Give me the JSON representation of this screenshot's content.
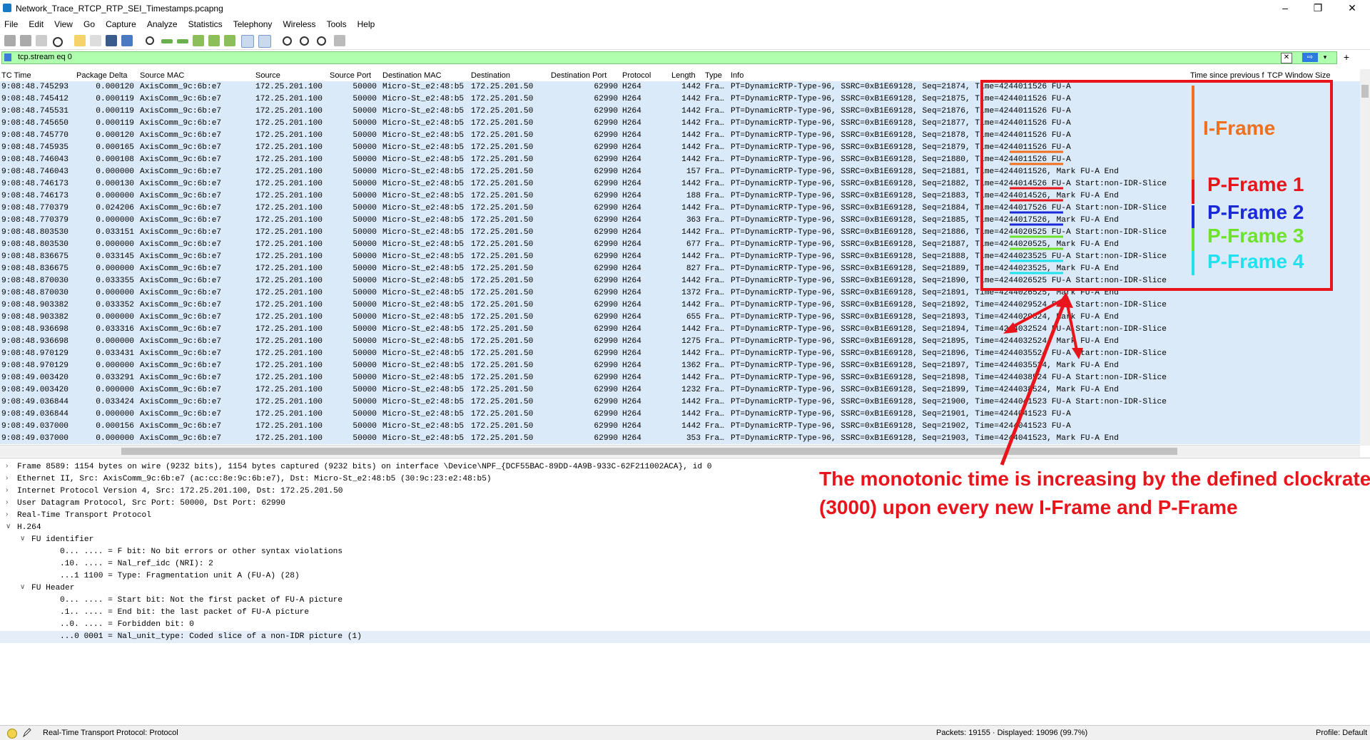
{
  "window": {
    "title": "Network_Trace_RTCP_RTP_SEI_Timestamps.pcapng",
    "min": "–",
    "max": "❐",
    "close": "✕"
  },
  "menu": [
    "File",
    "Edit",
    "View",
    "Go",
    "Capture",
    "Analyze",
    "Statistics",
    "Telephony",
    "Wireless",
    "Tools",
    "Help"
  ],
  "filter": {
    "value": "tcp.stream eq 0",
    "clear": "✕",
    "apply": "⇨",
    "dropdown": "▾",
    "add": "+"
  },
  "columns": [
    "TC Time",
    "Package Delta",
    "Source MAC",
    "Source",
    "Source Port",
    "Destination MAC",
    "Destination",
    "Destination Port",
    "Protocol",
    "Length",
    "Type",
    "Info",
    "Time since previous f",
    "TCP Window Size"
  ],
  "packets": [
    {
      "time": "9:08:48.745293",
      "delta": "0.000120",
      "smac": "AxisComm_9c:6b:e7",
      "src": "172.25.201.100",
      "sport": "50000",
      "dmac": "Micro-St_e2:48:b5",
      "dst": "172.25.201.50",
      "dport": "62990",
      "proto": "H264",
      "len": "1442",
      "type": "Fra…",
      "info": "PT=DynamicRTP-Type-96, SSRC=0xB1E69128, Seq=21874, Time=4244011526 FU-A"
    },
    {
      "time": "9:08:48.745412",
      "delta": "0.000119",
      "smac": "AxisComm_9c:6b:e7",
      "src": "172.25.201.100",
      "sport": "50000",
      "dmac": "Micro-St_e2:48:b5",
      "dst": "172.25.201.50",
      "dport": "62990",
      "proto": "H264",
      "len": "1442",
      "type": "Fra…",
      "info": "PT=DynamicRTP-Type-96, SSRC=0xB1E69128, Seq=21875, Time=4244011526 FU-A"
    },
    {
      "time": "9:08:48.745531",
      "delta": "0.000119",
      "smac": "AxisComm_9c:6b:e7",
      "src": "172.25.201.100",
      "sport": "50000",
      "dmac": "Micro-St_e2:48:b5",
      "dst": "172.25.201.50",
      "dport": "62990",
      "proto": "H264",
      "len": "1442",
      "type": "Fra…",
      "info": "PT=DynamicRTP-Type-96, SSRC=0xB1E69128, Seq=21876, Time=4244011526 FU-A"
    },
    {
      "time": "9:08:48.745650",
      "delta": "0.000119",
      "smac": "AxisComm_9c:6b:e7",
      "src": "172.25.201.100",
      "sport": "50000",
      "dmac": "Micro-St_e2:48:b5",
      "dst": "172.25.201.50",
      "dport": "62990",
      "proto": "H264",
      "len": "1442",
      "type": "Fra…",
      "info": "PT=DynamicRTP-Type-96, SSRC=0xB1E69128, Seq=21877, Time=4244011526 FU-A"
    },
    {
      "time": "9:08:48.745770",
      "delta": "0.000120",
      "smac": "AxisComm_9c:6b:e7",
      "src": "172.25.201.100",
      "sport": "50000",
      "dmac": "Micro-St_e2:48:b5",
      "dst": "172.25.201.50",
      "dport": "62990",
      "proto": "H264",
      "len": "1442",
      "type": "Fra…",
      "info": "PT=DynamicRTP-Type-96, SSRC=0xB1E69128, Seq=21878, Time=4244011526 FU-A"
    },
    {
      "time": "9:08:48.745935",
      "delta": "0.000165",
      "smac": "AxisComm_9c:6b:e7",
      "src": "172.25.201.100",
      "sport": "50000",
      "dmac": "Micro-St_e2:48:b5",
      "dst": "172.25.201.50",
      "dport": "62990",
      "proto": "H264",
      "len": "1442",
      "type": "Fra…",
      "info": "PT=DynamicRTP-Type-96, SSRC=0xB1E69128, Seq=21879, Time=4244011526 FU-A"
    },
    {
      "time": "9:08:48.746043",
      "delta": "0.000108",
      "smac": "AxisComm_9c:6b:e7",
      "src": "172.25.201.100",
      "sport": "50000",
      "dmac": "Micro-St_e2:48:b5",
      "dst": "172.25.201.50",
      "dport": "62990",
      "proto": "H264",
      "len": "1442",
      "type": "Fra…",
      "info": "PT=DynamicRTP-Type-96, SSRC=0xB1E69128, Seq=21880, Time=4244011526 FU-A"
    },
    {
      "time": "9:08:48.746043",
      "delta": "0.000000",
      "smac": "AxisComm_9c:6b:e7",
      "src": "172.25.201.100",
      "sport": "50000",
      "dmac": "Micro-St_e2:48:b5",
      "dst": "172.25.201.50",
      "dport": "62990",
      "proto": "H264",
      "len": "157",
      "type": "Fra…",
      "info": "PT=DynamicRTP-Type-96, SSRC=0xB1E69128, Seq=21881, Time=4244011526, Mark FU-A End"
    },
    {
      "time": "9:08:48.746173",
      "delta": "0.000130",
      "smac": "AxisComm_9c:6b:e7",
      "src": "172.25.201.100",
      "sport": "50000",
      "dmac": "Micro-St_e2:48:b5",
      "dst": "172.25.201.50",
      "dport": "62990",
      "proto": "H264",
      "len": "1442",
      "type": "Fra…",
      "info": "PT=DynamicRTP-Type-96, SSRC=0xB1E69128, Seq=21882, Time=4244014526 FU-A Start:non-IDR-Slice"
    },
    {
      "time": "9:08:48.746173",
      "delta": "0.000000",
      "smac": "AxisComm_9c:6b:e7",
      "src": "172.25.201.100",
      "sport": "50000",
      "dmac": "Micro-St_e2:48:b5",
      "dst": "172.25.201.50",
      "dport": "62990",
      "proto": "H264",
      "len": "188",
      "type": "Fra…",
      "info": "PT=DynamicRTP-Type-96, SSRC=0xB1E69128, Seq=21883, Time=4244014526, Mark FU-A End"
    },
    {
      "time": "9:08:48.770379",
      "delta": "0.024206",
      "smac": "AxisComm_9c:6b:e7",
      "src": "172.25.201.100",
      "sport": "50000",
      "dmac": "Micro-St_e2:48:b5",
      "dst": "172.25.201.50",
      "dport": "62990",
      "proto": "H264",
      "len": "1442",
      "type": "Fra…",
      "info": "PT=DynamicRTP-Type-96, SSRC=0xB1E69128, Seq=21884, Time=4244017526 FU-A Start:non-IDR-Slice"
    },
    {
      "time": "9:08:48.770379",
      "delta": "0.000000",
      "smac": "AxisComm_9c:6b:e7",
      "src": "172.25.201.100",
      "sport": "50000",
      "dmac": "Micro-St_e2:48:b5",
      "dst": "172.25.201.50",
      "dport": "62990",
      "proto": "H264",
      "len": "363",
      "type": "Fra…",
      "info": "PT=DynamicRTP-Type-96, SSRC=0xB1E69128, Seq=21885, Time=4244017526, Mark FU-A End"
    },
    {
      "time": "9:08:48.803530",
      "delta": "0.033151",
      "smac": "AxisComm_9c:6b:e7",
      "src": "172.25.201.100",
      "sport": "50000",
      "dmac": "Micro-St_e2:48:b5",
      "dst": "172.25.201.50",
      "dport": "62990",
      "proto": "H264",
      "len": "1442",
      "type": "Fra…",
      "info": "PT=DynamicRTP-Type-96, SSRC=0xB1E69128, Seq=21886, Time=4244020525 FU-A Start:non-IDR-Slice"
    },
    {
      "time": "9:08:48.803530",
      "delta": "0.000000",
      "smac": "AxisComm_9c:6b:e7",
      "src": "172.25.201.100",
      "sport": "50000",
      "dmac": "Micro-St_e2:48:b5",
      "dst": "172.25.201.50",
      "dport": "62990",
      "proto": "H264",
      "len": "677",
      "type": "Fra…",
      "info": "PT=DynamicRTP-Type-96, SSRC=0xB1E69128, Seq=21887, Time=4244020525, Mark FU-A End"
    },
    {
      "time": "9:08:48.836675",
      "delta": "0.033145",
      "smac": "AxisComm_9c:6b:e7",
      "src": "172.25.201.100",
      "sport": "50000",
      "dmac": "Micro-St_e2:48:b5",
      "dst": "172.25.201.50",
      "dport": "62990",
      "proto": "H264",
      "len": "1442",
      "type": "Fra…",
      "info": "PT=DynamicRTP-Type-96, SSRC=0xB1E69128, Seq=21888, Time=4244023525 FU-A Start:non-IDR-Slice"
    },
    {
      "time": "9:08:48.836675",
      "delta": "0.000000",
      "smac": "AxisComm_9c:6b:e7",
      "src": "172.25.201.100",
      "sport": "50000",
      "dmac": "Micro-St_e2:48:b5",
      "dst": "172.25.201.50",
      "dport": "62990",
      "proto": "H264",
      "len": "827",
      "type": "Fra…",
      "info": "PT=DynamicRTP-Type-96, SSRC=0xB1E69128, Seq=21889, Time=4244023525, Mark FU-A End"
    },
    {
      "time": "9:08:48.870030",
      "delta": "0.033355",
      "smac": "AxisComm_9c:6b:e7",
      "src": "172.25.201.100",
      "sport": "50000",
      "dmac": "Micro-St_e2:48:b5",
      "dst": "172.25.201.50",
      "dport": "62990",
      "proto": "H264",
      "len": "1442",
      "type": "Fra…",
      "info": "PT=DynamicRTP-Type-96, SSRC=0xB1E69128, Seq=21890, Time=4244026525 FU-A Start:non-IDR-Slice"
    },
    {
      "time": "9:08:48.870030",
      "delta": "0.000000",
      "smac": "AxisComm_9c:6b:e7",
      "src": "172.25.201.100",
      "sport": "50000",
      "dmac": "Micro-St_e2:48:b5",
      "dst": "172.25.201.50",
      "dport": "62990",
      "proto": "H264",
      "len": "1372",
      "type": "Fra…",
      "info": "PT=DynamicRTP-Type-96, SSRC=0xB1E69128, Seq=21891, Time=4244026525, Mark FU-A End"
    },
    {
      "time": "9:08:48.903382",
      "delta": "0.033352",
      "smac": "AxisComm_9c:6b:e7",
      "src": "172.25.201.100",
      "sport": "50000",
      "dmac": "Micro-St_e2:48:b5",
      "dst": "172.25.201.50",
      "dport": "62990",
      "proto": "H264",
      "len": "1442",
      "type": "Fra…",
      "info": "PT=DynamicRTP-Type-96, SSRC=0xB1E69128, Seq=21892, Time=4244029524 FU-A Start:non-IDR-Slice"
    },
    {
      "time": "9:08:48.903382",
      "delta": "0.000000",
      "smac": "AxisComm_9c:6b:e7",
      "src": "172.25.201.100",
      "sport": "50000",
      "dmac": "Micro-St_e2:48:b5",
      "dst": "172.25.201.50",
      "dport": "62990",
      "proto": "H264",
      "len": "655",
      "type": "Fra…",
      "info": "PT=DynamicRTP-Type-96, SSRC=0xB1E69128, Seq=21893, Time=4244029524, Mark FU-A End"
    },
    {
      "time": "9:08:48.936698",
      "delta": "0.033316",
      "smac": "AxisComm_9c:6b:e7",
      "src": "172.25.201.100",
      "sport": "50000",
      "dmac": "Micro-St_e2:48:b5",
      "dst": "172.25.201.50",
      "dport": "62990",
      "proto": "H264",
      "len": "1442",
      "type": "Fra…",
      "info": "PT=DynamicRTP-Type-96, SSRC=0xB1E69128, Seq=21894, Time=4244032524 FU-A Start:non-IDR-Slice"
    },
    {
      "time": "9:08:48.936698",
      "delta": "0.000000",
      "smac": "AxisComm_9c:6b:e7",
      "src": "172.25.201.100",
      "sport": "50000",
      "dmac": "Micro-St_e2:48:b5",
      "dst": "172.25.201.50",
      "dport": "62990",
      "proto": "H264",
      "len": "1275",
      "type": "Fra…",
      "info": "PT=DynamicRTP-Type-96, SSRC=0xB1E69128, Seq=21895, Time=4244032524, Mark FU-A End"
    },
    {
      "time": "9:08:48.970129",
      "delta": "0.033431",
      "smac": "AxisComm_9c:6b:e7",
      "src": "172.25.201.100",
      "sport": "50000",
      "dmac": "Micro-St_e2:48:b5",
      "dst": "172.25.201.50",
      "dport": "62990",
      "proto": "H264",
      "len": "1442",
      "type": "Fra…",
      "info": "PT=DynamicRTP-Type-96, SSRC=0xB1E69128, Seq=21896, Time=4244035524 FU-A Start:non-IDR-Slice"
    },
    {
      "time": "9:08:48.970129",
      "delta": "0.000000",
      "smac": "AxisComm_9c:6b:e7",
      "src": "172.25.201.100",
      "sport": "50000",
      "dmac": "Micro-St_e2:48:b5",
      "dst": "172.25.201.50",
      "dport": "62990",
      "proto": "H264",
      "len": "1362",
      "type": "Fra…",
      "info": "PT=DynamicRTP-Type-96, SSRC=0xB1E69128, Seq=21897, Time=4244035524, Mark FU-A End"
    },
    {
      "time": "9:08:49.003420",
      "delta": "0.033291",
      "smac": "AxisComm_9c:6b:e7",
      "src": "172.25.201.100",
      "sport": "50000",
      "dmac": "Micro-St_e2:48:b5",
      "dst": "172.25.201.50",
      "dport": "62990",
      "proto": "H264",
      "len": "1442",
      "type": "Fra…",
      "info": "PT=DynamicRTP-Type-96, SSRC=0xB1E69128, Seq=21898, Time=4244038524 FU-A Start:non-IDR-Slice"
    },
    {
      "time": "9:08:49.003420",
      "delta": "0.000000",
      "smac": "AxisComm_9c:6b:e7",
      "src": "172.25.201.100",
      "sport": "50000",
      "dmac": "Micro-St_e2:48:b5",
      "dst": "172.25.201.50",
      "dport": "62990",
      "proto": "H264",
      "len": "1232",
      "type": "Fra…",
      "info": "PT=DynamicRTP-Type-96, SSRC=0xB1E69128, Seq=21899, Time=4244038524, Mark FU-A End"
    },
    {
      "time": "9:08:49.036844",
      "delta": "0.033424",
      "smac": "AxisComm_9c:6b:e7",
      "src": "172.25.201.100",
      "sport": "50000",
      "dmac": "Micro-St_e2:48:b5",
      "dst": "172.25.201.50",
      "dport": "62990",
      "proto": "H264",
      "len": "1442",
      "type": "Fra…",
      "info": "PT=DynamicRTP-Type-96, SSRC=0xB1E69128, Seq=21900, Time=4244041523 FU-A Start:non-IDR-Slice"
    },
    {
      "time": "9:08:49.036844",
      "delta": "0.000000",
      "smac": "AxisComm_9c:6b:e7",
      "src": "172.25.201.100",
      "sport": "50000",
      "dmac": "Micro-St_e2:48:b5",
      "dst": "172.25.201.50",
      "dport": "62990",
      "proto": "H264",
      "len": "1442",
      "type": "Fra…",
      "info": "PT=DynamicRTP-Type-96, SSRC=0xB1E69128, Seq=21901, Time=4244041523 FU-A"
    },
    {
      "time": "9:08:49.037000",
      "delta": "0.000156",
      "smac": "AxisComm_9c:6b:e7",
      "src": "172.25.201.100",
      "sport": "50000",
      "dmac": "Micro-St_e2:48:b5",
      "dst": "172.25.201.50",
      "dport": "62990",
      "proto": "H264",
      "len": "1442",
      "type": "Fra…",
      "info": "PT=DynamicRTP-Type-96, SSRC=0xB1E69128, Seq=21902, Time=4244041523 FU-A"
    },
    {
      "time": "9:08:49.037000",
      "delta": "0.000000",
      "smac": "AxisComm_9c:6b:e7",
      "src": "172.25.201.100",
      "sport": "50000",
      "dmac": "Micro-St_e2:48:b5",
      "dst": "172.25.201.50",
      "dport": "62990",
      "proto": "H264",
      "len": "353",
      "type": "Fra…",
      "info": "PT=DynamicRTP-Type-96, SSRC=0xB1E69128, Seq=21903, Time=4244041523, Mark FU-A End"
    }
  ],
  "details": [
    {
      "text": "Frame 8589: 1154 bytes on wire (9232 bits), 1154 bytes captured (9232 bits) on interface \\Device\\NPF_{DCF55BAC-89DD-4A9B-933C-62F211002ACA}, id 0",
      "exp": "›",
      "indent": 0
    },
    {
      "text": "Ethernet II, Src: AxisComm_9c:6b:e7 (ac:cc:8e:9c:6b:e7), Dst: Micro-St_e2:48:b5 (30:9c:23:e2:48:b5)",
      "exp": "›",
      "indent": 0
    },
    {
      "text": "Internet Protocol Version 4, Src: 172.25.201.100, Dst: 172.25.201.50",
      "exp": "›",
      "indent": 0
    },
    {
      "text": "User Datagram Protocol, Src Port: 50000, Dst Port: 62990",
      "exp": "›",
      "indent": 0
    },
    {
      "text": "Real-Time Transport Protocol",
      "exp": "›",
      "indent": 0
    },
    {
      "text": "H.264",
      "exp": "∨",
      "indent": 0
    },
    {
      "text": "FU identifier",
      "exp": "∨",
      "indent": 1
    },
    {
      "text": "0... .... = F bit: No bit errors or other syntax violations",
      "exp": "",
      "indent": 2
    },
    {
      "text": ".10. .... = Nal_ref_idc (NRI): 2",
      "exp": "",
      "indent": 2
    },
    {
      "text": "...1 1100 = Type: Fragmentation unit A (FU-A) (28)",
      "exp": "",
      "indent": 2
    },
    {
      "text": "FU Header",
      "exp": "∨",
      "indent": 1
    },
    {
      "text": "0... .... = Start bit: Not the first packet of FU-A picture",
      "exp": "",
      "indent": 2
    },
    {
      "text": ".1.. .... = End bit: the last packet of FU-A picture",
      "exp": "",
      "indent": 2
    },
    {
      "text": "..0. .... = Forbidden bit: 0",
      "exp": "",
      "indent": 2
    },
    {
      "text": "...0 0001 = Nal_unit_type: Coded slice of a non-IDR picture (1)",
      "exp": "",
      "indent": 2
    }
  ],
  "status": {
    "left": "Real-Time Transport Protocol: Protocol",
    "packets": "Packets: 19155 · Displayed: 19096 (99.7%)",
    "profile": "Profile: Default"
  },
  "annotations": {
    "iframe": {
      "label": "I-Frame",
      "color": "#f07020"
    },
    "p1": {
      "label": "P-Frame 1",
      "color": "#e8161c"
    },
    "p2": {
      "label": "P-Frame 2",
      "color": "#1a2ad8"
    },
    "p3": {
      "label": "P-Frame 3",
      "color": "#6ee22c"
    },
    "p4": {
      "label": "P-Frame 4",
      "color": "#1fe2ee"
    },
    "note_line1": "The monotonic time is increasing by the defined clockrate",
    "note_line2": "(3000) upon every new I-Frame and P-Frame",
    "note_color": "#e8161c"
  }
}
